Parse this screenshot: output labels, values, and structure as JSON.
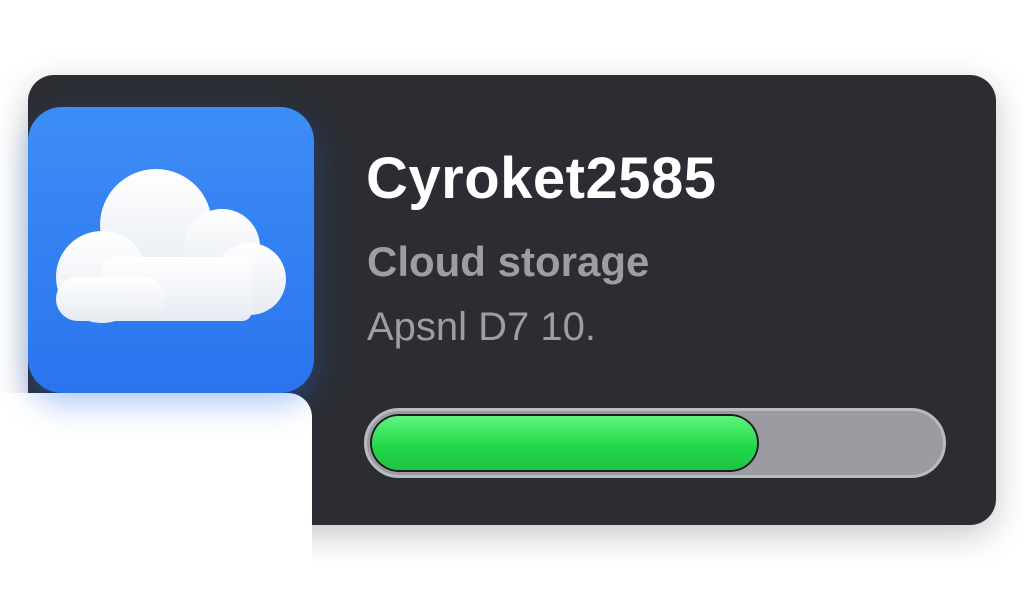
{
  "widget": {
    "account_name": "Cyroket2585",
    "service_label": "Cloud storage",
    "detail_line": "Apsnl D7 10.",
    "icon": "cloud-icon",
    "storage_progress": 0.68
  },
  "colors": {
    "card_background": "#2b2d33",
    "icon_background": "#2f7cf2",
    "progress_fill": "#2ee055",
    "progress_track": "#9a9ca1",
    "secondary_text": "#9c9ea4"
  }
}
